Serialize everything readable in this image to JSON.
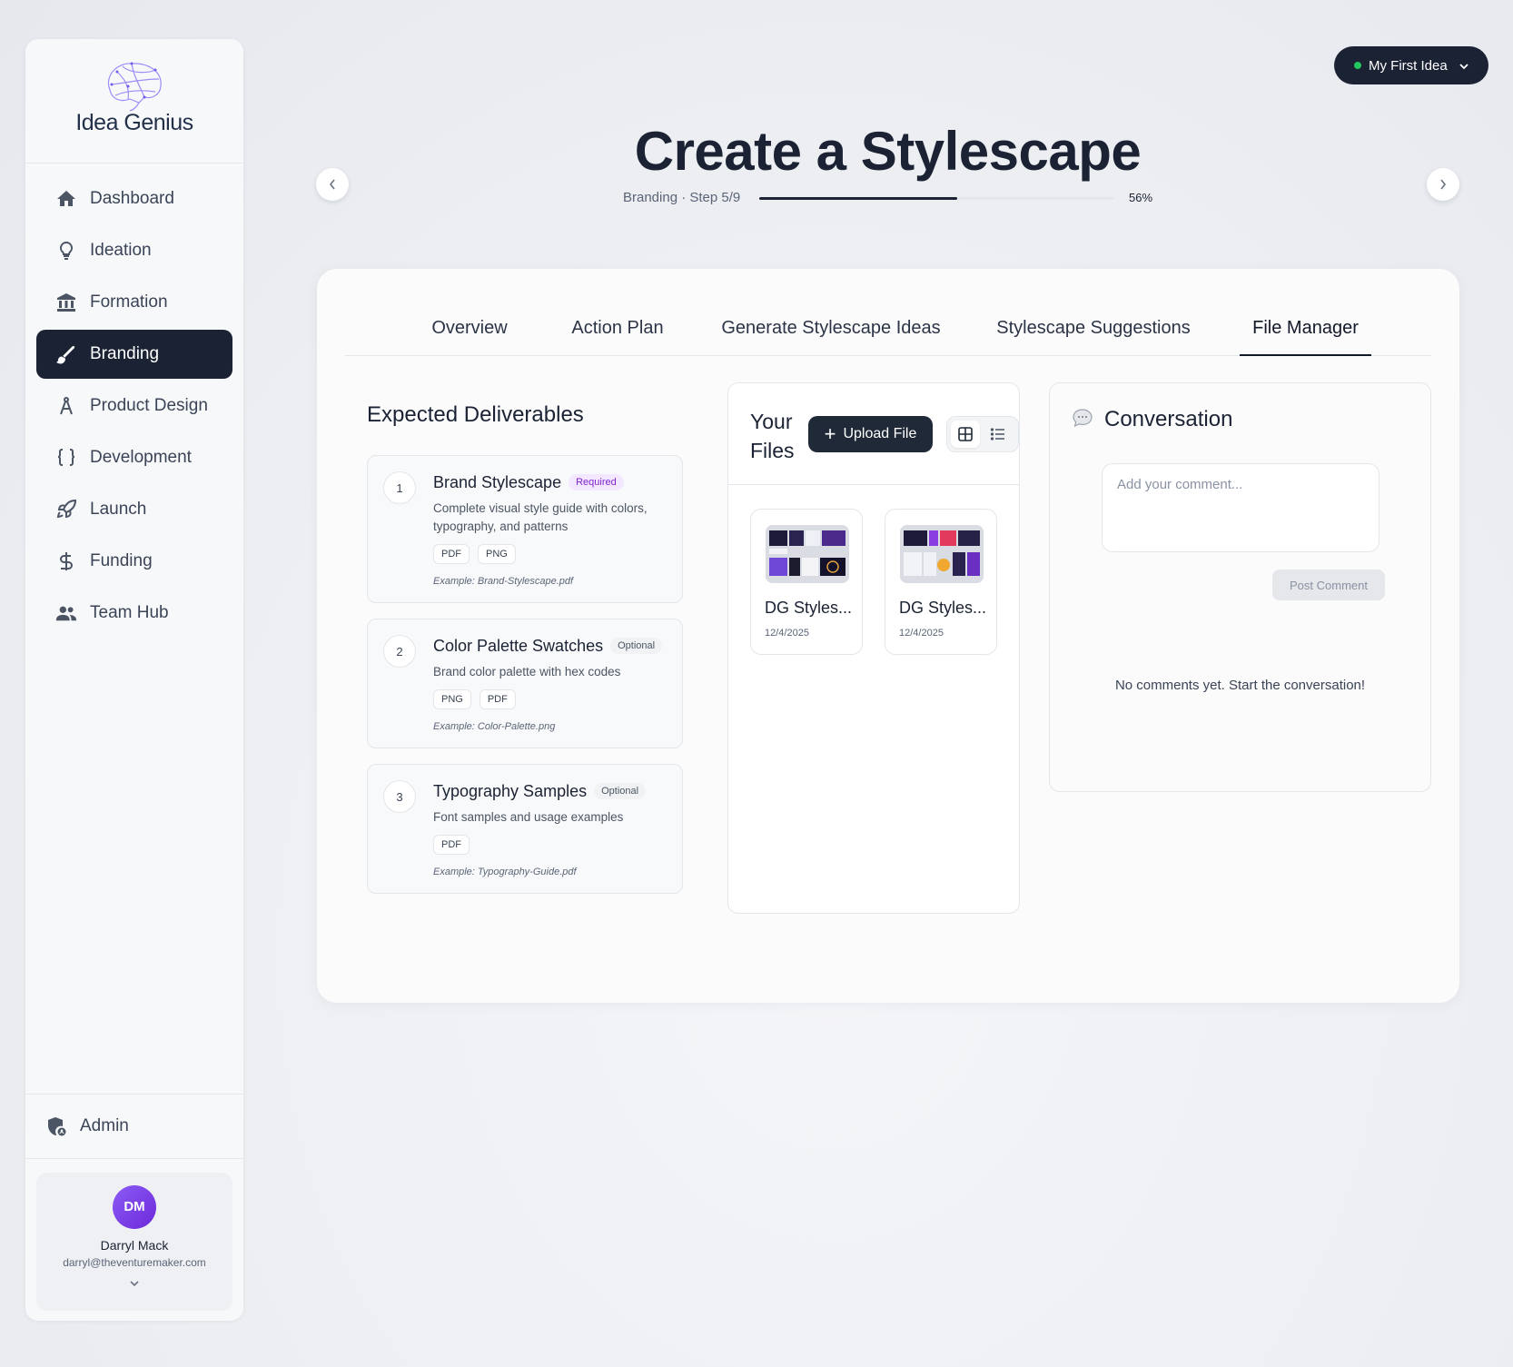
{
  "app": {
    "name": "Idea Genius"
  },
  "sidebar": {
    "items": [
      {
        "label": "Dashboard",
        "icon": "home-icon"
      },
      {
        "label": "Ideation",
        "icon": "lightbulb-icon"
      },
      {
        "label": "Formation",
        "icon": "bank-icon"
      },
      {
        "label": "Branding",
        "icon": "brush-icon",
        "active": true
      },
      {
        "label": "Product Design",
        "icon": "compass-icon"
      },
      {
        "label": "Development",
        "icon": "code-braces-icon"
      },
      {
        "label": "Launch",
        "icon": "rocket-icon"
      },
      {
        "label": "Funding",
        "icon": "dollar-icon"
      },
      {
        "label": "Team Hub",
        "icon": "team-icon"
      }
    ],
    "admin_label": "Admin",
    "user": {
      "initials": "DM",
      "name": "Darryl Mack",
      "email": "darryl@theventuremaker.com"
    }
  },
  "idea_selector": {
    "label": "My First Idea",
    "status_color": "#22c55e"
  },
  "header": {
    "title": "Create a Stylescape",
    "step_label": "Branding · Step 5/9",
    "progress_text": "56%",
    "progress_value": 0.56
  },
  "tabs": [
    {
      "label": "Overview"
    },
    {
      "label": "Action Plan"
    },
    {
      "label": "Generate Stylescape Ideas"
    },
    {
      "label": "Stylescape Suggestions"
    },
    {
      "label": "File Manager",
      "active": true
    }
  ],
  "deliverables": {
    "title": "Expected Deliverables",
    "items": [
      {
        "number": "1",
        "name": "Brand Stylescape",
        "badge": "Required",
        "description": "Complete visual style guide with colors, typography, and patterns",
        "formats": [
          "PDF",
          "PNG"
        ],
        "example": "Example: Brand-Stylescape.pdf"
      },
      {
        "number": "2",
        "name": "Color Palette Swatches",
        "badge": "Optional",
        "description": "Brand color palette with hex codes",
        "formats": [
          "PNG",
          "PDF"
        ],
        "example": "Example: Color-Palette.png"
      },
      {
        "number": "3",
        "name": "Typography Samples",
        "badge": "Optional",
        "description": "Font samples and usage examples",
        "formats": [
          "PDF"
        ],
        "example": "Example: Typography-Guide.pdf"
      }
    ]
  },
  "files": {
    "title": "Your Files",
    "upload_label": "Upload File",
    "items": [
      {
        "name": "DG Styles...",
        "date": "12/4/2025"
      },
      {
        "name": "DG Styles...",
        "date": "12/4/2025"
      }
    ]
  },
  "conversation": {
    "title": "Conversation",
    "placeholder": "Add your comment...",
    "post_label": "Post Comment",
    "empty_text": "No comments yet. Start the conversation!"
  },
  "colors": {
    "primary_dark": "#1a2233",
    "required_badge": "#7e22ce",
    "avatar": "#7c3aed"
  }
}
